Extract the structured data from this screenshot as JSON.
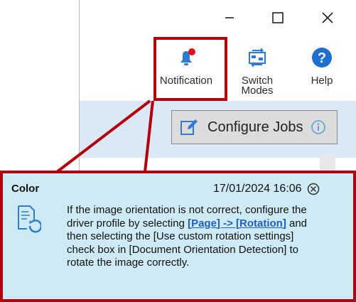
{
  "window_controls": {
    "minimize": "minimize",
    "maximize": "maximize",
    "close": "close"
  },
  "toolbar": {
    "notification_label": "Notification",
    "switch_modes_label_line1": "Switch",
    "switch_modes_label_line2": "Modes",
    "help_label": "Help"
  },
  "configure_jobs": {
    "label": "Configure Jobs"
  },
  "notification_popup": {
    "title": "Color",
    "timestamp": "17/01/2024 16:06",
    "message_part1": "If the image orientation is not correct, configure the driver profile by selecting ",
    "message_link": "[Page] -> [Rotation]",
    "message_part2": " and then selecting the [Use custom rotation settings] check box in [Document Orientation Detection] to rotate the image correctly."
  },
  "colors": {
    "highlight_red": "#b3000c",
    "popup_background": "#cdeaf5",
    "band_blue": "#dbe8f5",
    "link_blue": "#1f5ec8",
    "icon_blue": "#2e7bd6"
  },
  "icons": [
    "bell-icon",
    "switch-modes-icon",
    "help-icon",
    "edit-icon",
    "info-icon",
    "close-circle-icon",
    "document-rotate-icon"
  ]
}
